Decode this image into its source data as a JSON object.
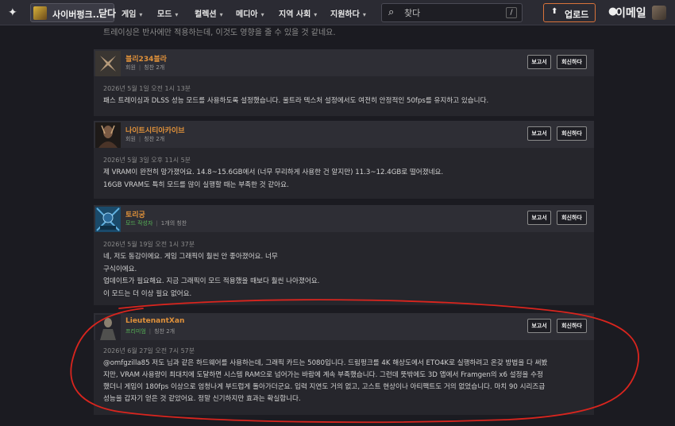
{
  "topbar": {
    "game_name": "사이버펑크...",
    "close_label": "닫다",
    "nav": [
      "게임",
      "모드",
      "컬렉션",
      "메디아",
      "지역 사회",
      "지원하다"
    ],
    "search_placeholder": "찾다",
    "search_shortcut": "/",
    "upload_label": "업로드",
    "email_label": "이메일"
  },
  "previous_text": "트레이싱은 반사에만 적용하는데, 이것도 영향을 줄 수 있을 것 같네요.",
  "buttons": {
    "report": "보고서",
    "reply": "회신하다"
  },
  "comments": [
    {
      "username": "블리234블라",
      "role": "회원",
      "endorsements": "칭찬 2개",
      "date": "2026년 5월 1일 오전 1시 13분",
      "body": [
        "패스 트레이싱과 DLSS 성능 모드를 사용하도록 설정했습니다. 울트라 텍스처 설정에서도 여전히 안정적인 50fps를 유지하고 있습니다."
      ]
    },
    {
      "username": "나이트시티아카이브",
      "role": "회원",
      "endorsements": "칭찬 2개",
      "date": "2026년 5월 3일 오후 11시 5분",
      "body": [
        "제 VRAM이 완전히 망가졌어요. 14.8~15.6GB에서 (너무 무리하게 사용한 건 알지만) 11.3~12.4GB로 떨어졌네요.",
        "16GB VRAM도 특히 모드를 많이 실행할 때는 부족한 것 같아요."
      ]
    },
    {
      "username": "토리궁",
      "role": "모드 작성자",
      "endorsements": "1개의 칭찬",
      "date": "2026년 5월 19일 오전 1시 37분",
      "body": [
        "네, 저도 동감이에요. 게임 그래픽이 훨씬 안 좋아졌어요. 너무",
        "구식이에요.",
        "업데이트가 필요해요. 지금 그래픽이 모드 적용했을 때보다 훨씬 나아졌어요.",
        "이 모드는 더 이상 필요 없어요."
      ]
    },
    {
      "username": "LieutenantXan",
      "role": "프리미엄",
      "endorsements": "칭찬 2개",
      "date": "2026년 6월 27일 오전 7시 57분",
      "body": [
        "@omfgzilla85 저도 님과 같은 하드웨어를 사용하는데, 그래픽 카드는 5080입니다. 드림펑크를 4K 해상도에서 ETO4K로 실행하려고 온갖 방법을 다 써봤",
        "지만, VRAM 사용량이 최대치에 도달하면 시스템 RAM으로 넘어가는 바람에 계속 부족했습니다. 그런데 뜻밖에도 3D 앱에서 Framgen의 x6 설정을 수정",
        "했더니 게임이 180fps 이상으로 엄청나게 부드럽게 돌아가더군요. 입력 지연도 거의 없고, 고스트 현상이나 아티팩트도 거의 없었습니다. 마치 90 시리즈급",
        "성능을 갑자기 얻은 것 같았어요. 정말 신기하지만 효과는 확실합니다."
      ]
    }
  ],
  "colors": {
    "username": "#e0913a",
    "role_green": "#57b457",
    "annotation": "#d9251e",
    "upload_border": "#d9733a"
  }
}
